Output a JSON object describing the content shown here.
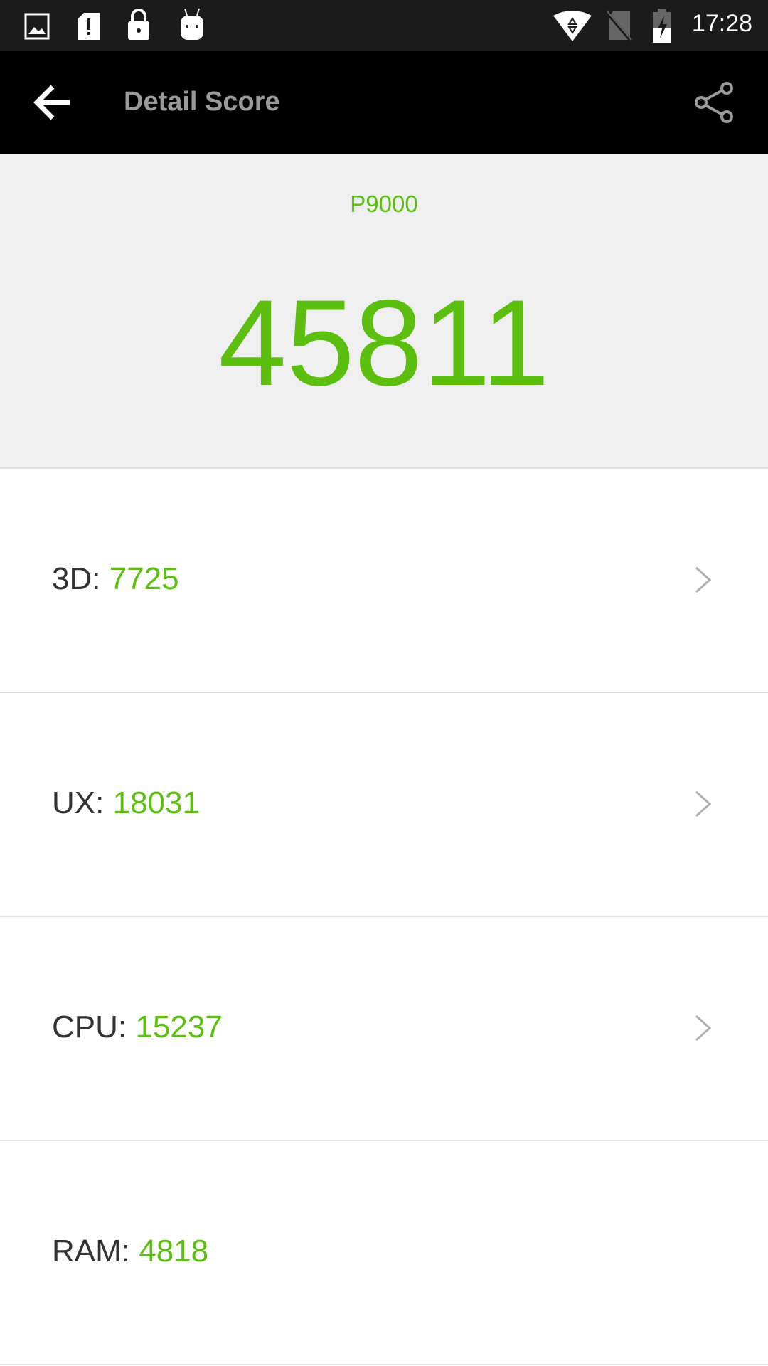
{
  "status_bar": {
    "icons": [
      "image-icon",
      "sim-alert-icon",
      "lock-icon",
      "android-icon",
      "wifi-icon",
      "no-sim-icon",
      "battery-charging-icon"
    ],
    "time": "17:28"
  },
  "toolbar": {
    "title": "Detail Score",
    "back_icon": "arrow-left-icon",
    "share_icon": "share-icon"
  },
  "summary": {
    "device": "P9000",
    "total_score": "45811"
  },
  "scores": [
    {
      "label": "3D:",
      "value": "7725",
      "has_chevron": true
    },
    {
      "label": "UX:",
      "value": "18031",
      "has_chevron": true
    },
    {
      "label": "CPU:",
      "value": "15237",
      "has_chevron": true
    },
    {
      "label": "RAM:",
      "value": "4818",
      "has_chevron": false
    }
  ],
  "colors": {
    "accent": "#5cbf0f",
    "toolbar": "#000000",
    "status_bar": "#1b1b1b",
    "hero_bg": "#efefef"
  }
}
